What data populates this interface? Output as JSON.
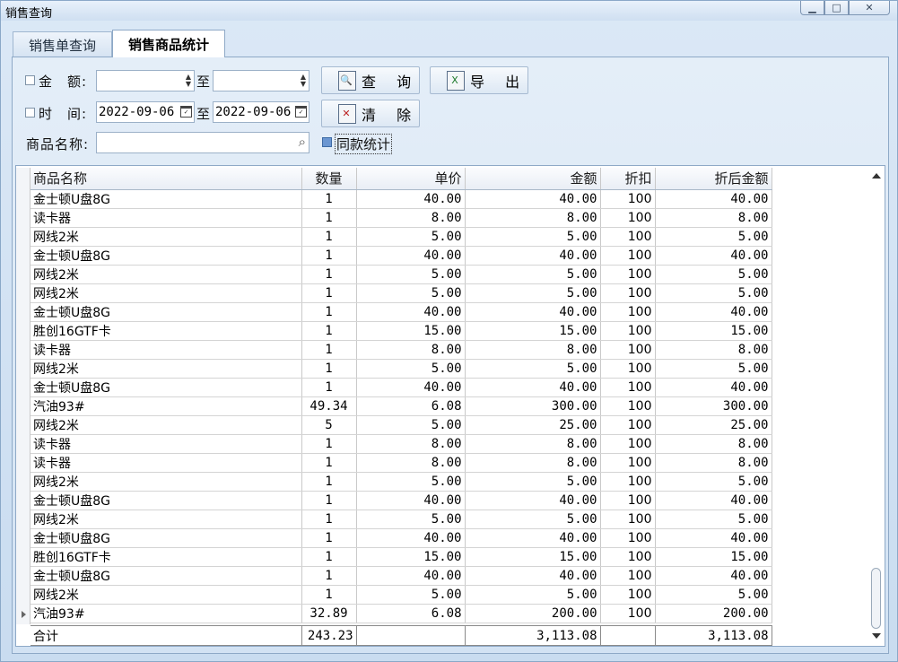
{
  "window": {
    "title": "销售查询",
    "controls": [
      "minimize-icon",
      "maximize-icon",
      "close-icon"
    ]
  },
  "tabs": [
    {
      "label": "销售单查询",
      "active": false
    },
    {
      "label": "销售商品统计",
      "active": true
    }
  ],
  "filters": {
    "amount_label": "金　额:",
    "amount_from": "",
    "amount_to": "",
    "to_label": "至",
    "time_label": "时　间:",
    "date_from": "2022-09-06",
    "date_to": "2022-09-06",
    "product_label": "商品名称:",
    "product_value": "",
    "same_style_label": "同款统计",
    "amount_checked": false,
    "time_checked": false,
    "same_style_checked": true
  },
  "buttons": {
    "query": "查 询",
    "export": "导 出",
    "clear": "清 除"
  },
  "table": {
    "columns": [
      "商品名称",
      "数量",
      "单价",
      "金额",
      "折扣",
      "折后金额"
    ],
    "rows": [
      [
        "金士顿U盘8G",
        "1",
        "40.00",
        "40.00",
        "100",
        "40.00"
      ],
      [
        "读卡器",
        "1",
        "8.00",
        "8.00",
        "100",
        "8.00"
      ],
      [
        "网线2米",
        "1",
        "5.00",
        "5.00",
        "100",
        "5.00"
      ],
      [
        "金士顿U盘8G",
        "1",
        "40.00",
        "40.00",
        "100",
        "40.00"
      ],
      [
        "网线2米",
        "1",
        "5.00",
        "5.00",
        "100",
        "5.00"
      ],
      [
        "网线2米",
        "1",
        "5.00",
        "5.00",
        "100",
        "5.00"
      ],
      [
        "金士顿U盘8G",
        "1",
        "40.00",
        "40.00",
        "100",
        "40.00"
      ],
      [
        "胜创16GTF卡",
        "1",
        "15.00",
        "15.00",
        "100",
        "15.00"
      ],
      [
        "读卡器",
        "1",
        "8.00",
        "8.00",
        "100",
        "8.00"
      ],
      [
        "网线2米",
        "1",
        "5.00",
        "5.00",
        "100",
        "5.00"
      ],
      [
        "金士顿U盘8G",
        "1",
        "40.00",
        "40.00",
        "100",
        "40.00"
      ],
      [
        "汽油93#",
        "49.34",
        "6.08",
        "300.00",
        "100",
        "300.00"
      ],
      [
        "网线2米",
        "5",
        "5.00",
        "25.00",
        "100",
        "25.00"
      ],
      [
        "读卡器",
        "1",
        "8.00",
        "8.00",
        "100",
        "8.00"
      ],
      [
        "读卡器",
        "1",
        "8.00",
        "8.00",
        "100",
        "8.00"
      ],
      [
        "网线2米",
        "1",
        "5.00",
        "5.00",
        "100",
        "5.00"
      ],
      [
        "金士顿U盘8G",
        "1",
        "40.00",
        "40.00",
        "100",
        "40.00"
      ],
      [
        "网线2米",
        "1",
        "5.00",
        "5.00",
        "100",
        "5.00"
      ],
      [
        "金士顿U盘8G",
        "1",
        "40.00",
        "40.00",
        "100",
        "40.00"
      ],
      [
        "胜创16GTF卡",
        "1",
        "15.00",
        "15.00",
        "100",
        "15.00"
      ],
      [
        "金士顿U盘8G",
        "1",
        "40.00",
        "40.00",
        "100",
        "40.00"
      ],
      [
        "网线2米",
        "1",
        "5.00",
        "5.00",
        "100",
        "5.00"
      ],
      [
        "汽油93#",
        "32.89",
        "6.08",
        "200.00",
        "100",
        "200.00"
      ]
    ],
    "total": [
      "合计",
      "243.23",
      "",
      "3,113.08",
      "",
      "3,113.08"
    ]
  }
}
